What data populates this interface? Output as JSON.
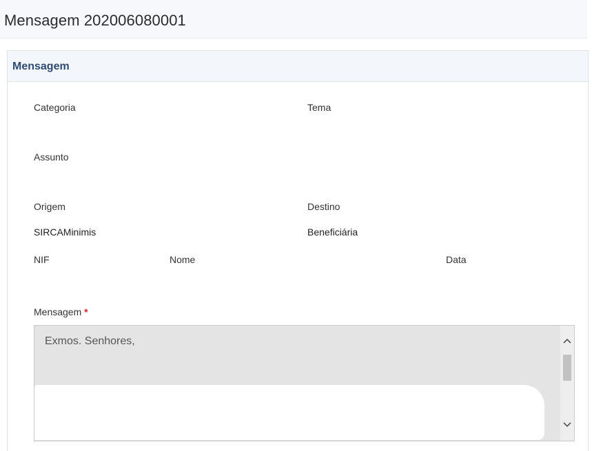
{
  "page": {
    "title": "Mensagem 202006080001"
  },
  "panel": {
    "title": "Mensagem"
  },
  "fields": {
    "categoria_label": "Categoria",
    "tema_label": "Tema",
    "assunto_label": "Assunto",
    "origem_label": "Origem",
    "origem_value": "SIRCAMinimis",
    "destino_label": "Destino",
    "destino_value": "Beneficiária",
    "nif_label": "NIF",
    "nome_label": "Nome",
    "data_label": "Data",
    "mensagem_label": "Mensagem",
    "mensagem_required": "*"
  },
  "message": {
    "text": "Exmos. Senhores,",
    "scroll_position": 0.15
  },
  "icons": {
    "scroll_up": "chevron-up-icon",
    "scroll_down": "chevron-down-icon"
  }
}
